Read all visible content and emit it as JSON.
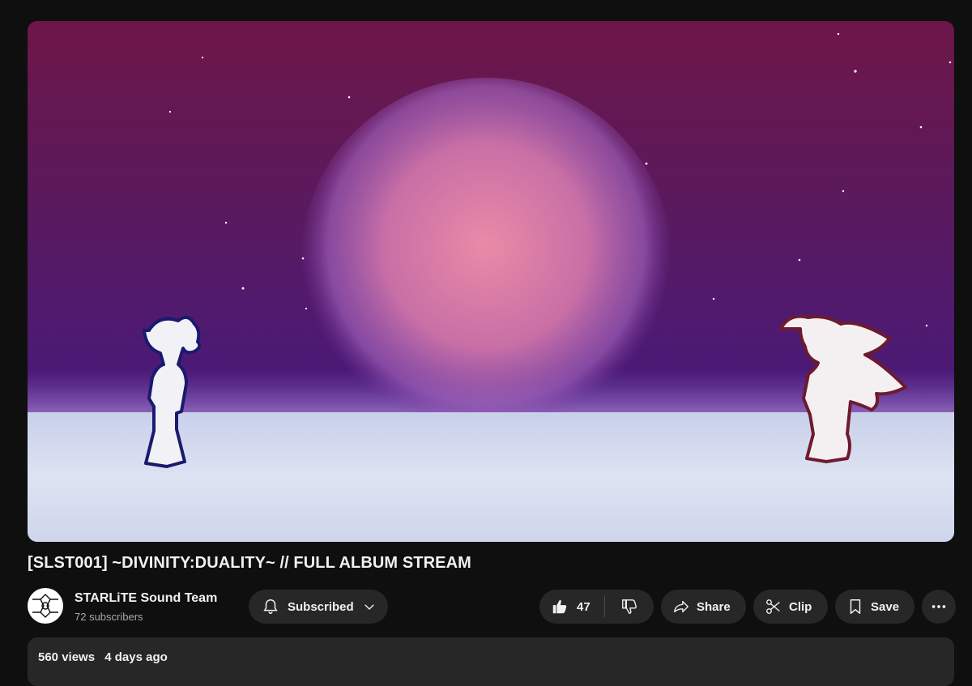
{
  "video": {
    "title": "[SLST001] ~DIVINITY:DUALITY~ // FULL ALBUM STREAM"
  },
  "channel": {
    "name": "STARLiTE Sound Team",
    "subscribers": "72 subscribers",
    "avatar_icon": "starlite-logo-icon"
  },
  "actions": {
    "subscribe_label": "Subscribed",
    "like_count": "47",
    "share_label": "Share",
    "clip_label": "Clip",
    "save_label": "Save"
  },
  "description": {
    "views": "560 views",
    "date": "4 days ago"
  },
  "colors": {
    "background": "#0f0f0f",
    "button_bg": "#272727",
    "text": "#f1f1f1",
    "secondary_text": "#aaaaaa"
  }
}
